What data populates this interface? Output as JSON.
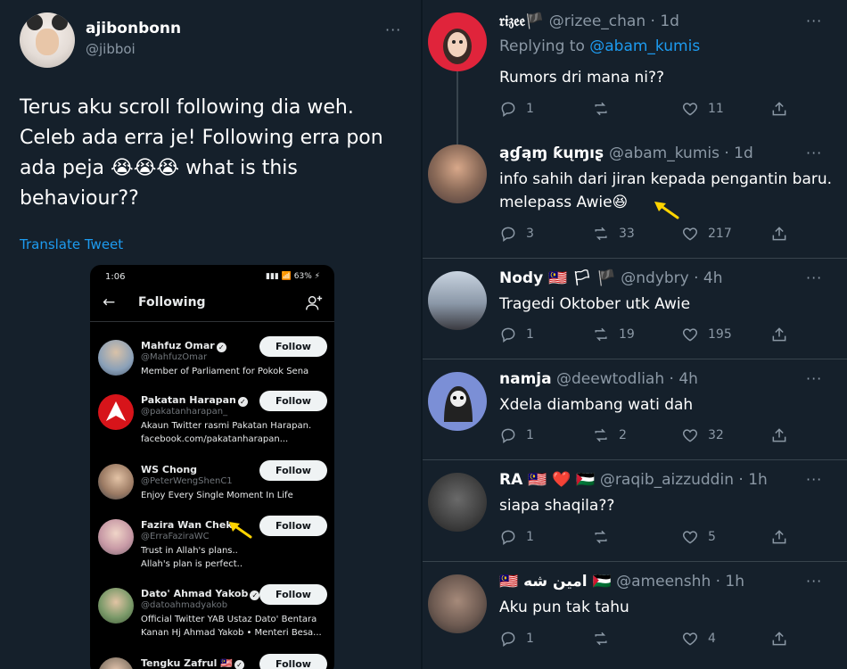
{
  "left_tweet": {
    "author_name": "ajibonbonn",
    "author_handle": "@jibboi",
    "more": "···",
    "text": "Terus aku scroll following dia weh.\nCeleb ada erra je! Following erra pon\nada peja 😭😭😭 what is this\nbehaviour??",
    "translate_label": "Translate Tweet"
  },
  "phone": {
    "time": "1:06",
    "status_icons": "▮▮▮ 📶 63% ⚡",
    "title": "Following",
    "back_icon": "arrow-left-icon",
    "add_icon": "add-person-icon",
    "follow_label": "Follow",
    "accounts": [
      {
        "name": "Mahfuz Omar",
        "verified": true,
        "handle": "@MahfuzOmar",
        "bio": "Member of Parliament for Pokok Sena"
      },
      {
        "name": "Pakatan Harapan",
        "verified": true,
        "handle": "@pakatanharapan_",
        "bio": "Akaun Twitter rasmi Pakatan Harapan.\nfacebook.com/pakatanharapan..."
      },
      {
        "name": "WS Chong",
        "verified": false,
        "handle": "@PeterWengShenC1",
        "bio": "Enjoy Every Single Moment In Life"
      },
      {
        "name": "Fazira Wan Chek",
        "verified": false,
        "handle": "@ErraFaziraWC",
        "bio": "Trust in Allah's plans..\nAllah's plan is perfect.."
      },
      {
        "name": "Dato' Ahmad Yakob",
        "verified": true,
        "handle": "@datoahmadyakob",
        "bio": "Official Twitter YAB Ustaz Dato' Bentara\nKanan Hj Ahmad Yakob • Menteri Besa..."
      },
      {
        "name": "Tengku Zafrul 🇲🇾",
        "verified": true,
        "handle": "",
        "bio": ""
      }
    ]
  },
  "replies": [
    {
      "name": "𝔯𝔦𝔷𝔢𝔢🏴",
      "handle": "@rizee_chan",
      "time": "· 1d",
      "replying_prefix": "Replying to",
      "replying_to": "@abam_kumis",
      "text": "Rumors dri mana ni??",
      "replies": "1",
      "retweets": "",
      "likes": "11"
    },
    {
      "name": "ąɠąɱ ƙųɱıʂ ",
      "handle": "@abam_kumis",
      "time": "· 1d",
      "text": "info sahih dari jiran kepada pengantin baru.\nmelepass Awie😆",
      "replies": "3",
      "retweets": "33",
      "likes": "217"
    },
    {
      "name": "Nody 🇲🇾 🏳 🏴",
      "handle": "@ndybry",
      "time": "· 4h",
      "text": "Tragedi Oktober utk Awie",
      "replies": "1",
      "retweets": "19",
      "likes": "195"
    },
    {
      "name": "namja",
      "handle": "@deewtodliah",
      "time": "· 4h",
      "text": "Xdela diambang wati dah",
      "replies": "1",
      "retweets": "2",
      "likes": "32"
    },
    {
      "name": "RA 🇲🇾 ❤️ 🇵🇸",
      "handle": "@raqib_aizzuddin",
      "time": "· 1h",
      "text": "siapa shaqila??",
      "replies": "1",
      "retweets": "",
      "likes": "5"
    },
    {
      "name": "🇲🇾 امين شه 🇵🇸",
      "handle": "@ameenshh",
      "time": "· 1h",
      "text": "Aku pun tak tahu",
      "replies": "1",
      "retweets": "",
      "likes": "4"
    }
  ],
  "more": "···",
  "colors": {
    "background": "#15202b",
    "accent": "#1d9bf0",
    "muted": "#8b98a5",
    "marker": "#ffd400"
  }
}
